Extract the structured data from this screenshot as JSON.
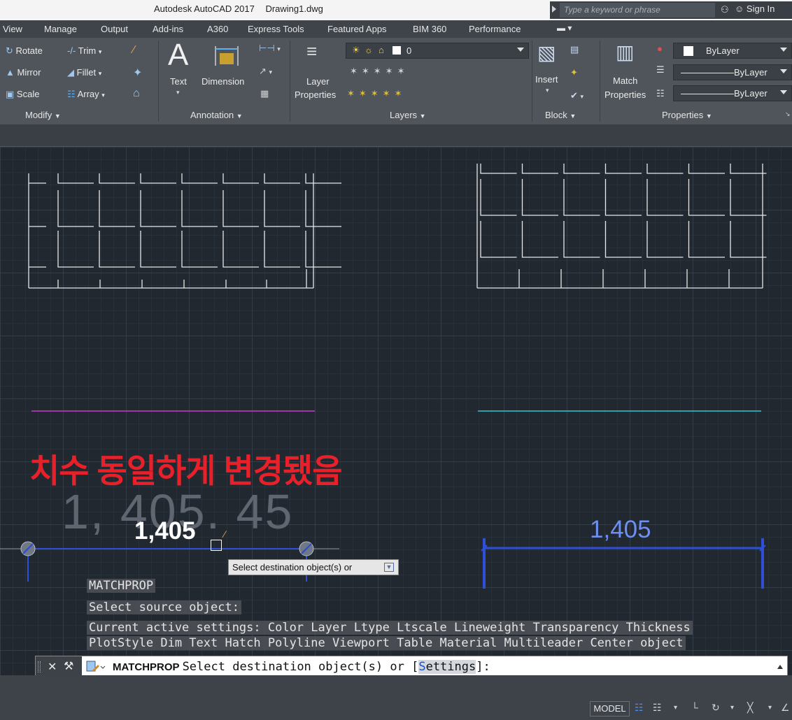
{
  "window": {
    "app_title": "Autodesk AutoCAD 2017",
    "file_name": "Drawing1.dwg",
    "search_placeholder": "Type a keyword or phrase",
    "sign_in": "Sign In"
  },
  "ribbon_tabs": [
    "View",
    "Manage",
    "Output",
    "Add-ins",
    "A360",
    "Express Tools",
    "Featured Apps",
    "BIM 360",
    "Performance"
  ],
  "ribbon": {
    "modify": {
      "rotate": "Rotate",
      "trim": "Trim",
      "mirror": "Mirror",
      "fillet": "Fillet",
      "scale": "Scale",
      "array": "Array",
      "title": "Modify"
    },
    "annotation": {
      "text": "Text",
      "dimension": "Dimension",
      "title": "Annotation"
    },
    "layers": {
      "layer_line1": "Layer",
      "layer_line2": "Properties",
      "current_layer": "0",
      "title": "Layers"
    },
    "block": {
      "insert": "Insert",
      "title": "Block"
    },
    "properties": {
      "match_line1": "Match",
      "match_line2": "Properties",
      "color": "ByLayer",
      "linetype": "ByLayer",
      "lineweight": "ByLayer",
      "title": "Properties"
    }
  },
  "canvas": {
    "annotation_korean": "치수 동일하게 변경됐음",
    "ghost_dimension": "1, 405. 45",
    "left_dimension": "1,405",
    "right_dimension": "1,405",
    "tooltip": "Select destination object(s) or"
  },
  "command_history": [
    "MATCHPROP",
    "Select source object:",
    "Current active settings:  Color Layer Ltype Ltscale Lineweight Transparency Thickness",
    "PlotStyle Dim Text Hatch Polyline Viewport Table Material Multileader Center object"
  ],
  "command_line": {
    "command": "MATCHPROP",
    "prompt": "Select destination object(s) or [",
    "option_hotkey": "S",
    "option_rest": "ettings",
    "prompt_end": "]:"
  },
  "status_bar": {
    "model": "MODEL"
  },
  "colors": {
    "canvas_bg": "#212830",
    "annotation_red": "#e8202a",
    "magenta_line": "#c73ad0",
    "cyan_line": "#36c6cf",
    "dimension_blue": "#2f4fd6",
    "ribbon_bg": "#50555c"
  }
}
